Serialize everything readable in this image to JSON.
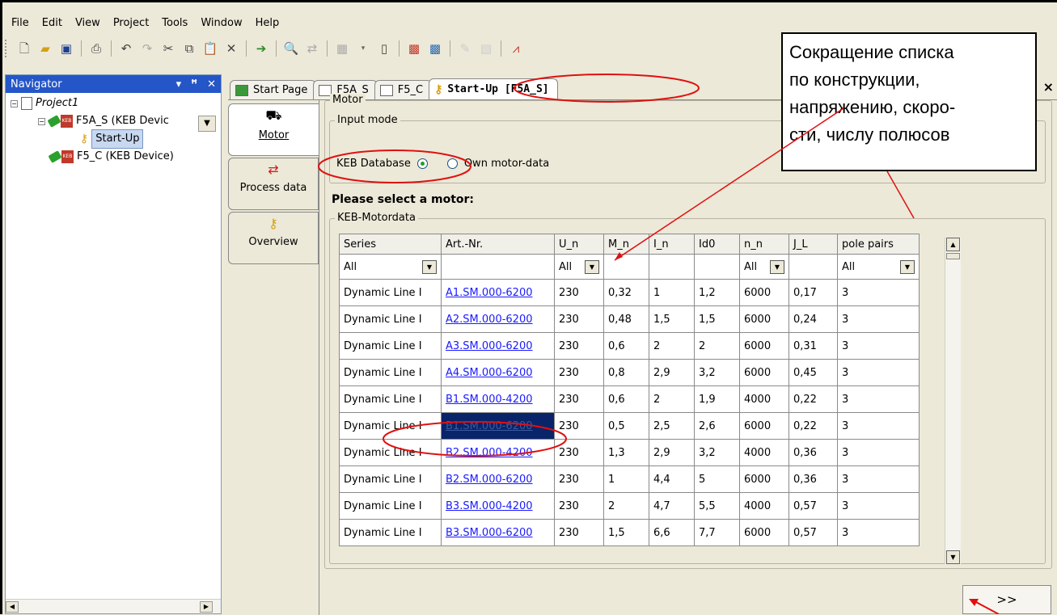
{
  "menu": [
    "File",
    "Edit",
    "View",
    "Project",
    "Tools",
    "Window",
    "Help"
  ],
  "navigator": {
    "title": "Navigator",
    "buttons": [
      "▾",
      "ꟸ",
      "✕"
    ],
    "project": "Project1",
    "device1": "F5A_S (KEB Devic",
    "startup": "Start-Up",
    "device2": "F5_C (KEB Device)"
  },
  "tabs": [
    "Start Page",
    "F5A_S",
    "F5_C",
    "Start-Up [F5A_S]"
  ],
  "side_tabs": [
    "Motor",
    "Process data",
    "Overview"
  ],
  "motor": {
    "group_title": "Motor",
    "input_mode_title": "Input mode",
    "radio_keb": "KEB Database",
    "radio_own": "Own motor-data",
    "please_select": "Please select a motor:",
    "motordata_title": "KEB-Motordata"
  },
  "table": {
    "columns": [
      "Series",
      "Art.-Nr.",
      "U_n",
      "M_n",
      "I_n",
      "Id0",
      "n_n",
      "J_L",
      "pole pairs"
    ],
    "filters": [
      "All",
      "",
      "All",
      "",
      "",
      "",
      "All",
      "",
      "All"
    ],
    "rows": [
      [
        "Dynamic Line I",
        "A1.SM.000-6200",
        "230",
        "0,32",
        "1",
        "1,2",
        "6000",
        "0,17",
        "3"
      ],
      [
        "Dynamic Line I",
        "A2.SM.000-6200",
        "230",
        "0,48",
        "1,5",
        "1,5",
        "6000",
        "0,24",
        "3"
      ],
      [
        "Dynamic Line I",
        "A3.SM.000-6200",
        "230",
        "0,6",
        "2",
        "2",
        "6000",
        "0,31",
        "3"
      ],
      [
        "Dynamic Line I",
        "A4.SM.000-6200",
        "230",
        "0,8",
        "2,9",
        "3,2",
        "6000",
        "0,45",
        "3"
      ],
      [
        "Dynamic Line I",
        "B1.SM.000-4200",
        "230",
        "0,6",
        "2",
        "1,9",
        "4000",
        "0,22",
        "3"
      ],
      [
        "Dynamic Line I",
        "B1.SM.000-6200",
        "230",
        "0,5",
        "2,5",
        "2,6",
        "6000",
        "0,22",
        "3"
      ],
      [
        "Dynamic Line I",
        "B2.SM.000-4200",
        "230",
        "1,3",
        "2,9",
        "3,2",
        "4000",
        "0,36",
        "3"
      ],
      [
        "Dynamic Line I",
        "B2.SM.000-6200",
        "230",
        "1",
        "4,4",
        "5",
        "6000",
        "0,36",
        "3"
      ],
      [
        "Dynamic Line I",
        "B3.SM.000-4200",
        "230",
        "2",
        "4,7",
        "5,5",
        "4000",
        "0,57",
        "3"
      ],
      [
        "Dynamic Line I",
        "B3.SM.000-6200",
        "230",
        "1,5",
        "6,6",
        "7,7",
        "6000",
        "0,57",
        "3"
      ]
    ],
    "selected_row": 5
  },
  "next_button": ">>",
  "close_icon_char": "×",
  "callout": [
    "Сокращение списка",
    "по конструкции,",
    "напряжению, скоро-",
    "сти, числу полюсов"
  ],
  "colors": {
    "annotation_red": "#e01010",
    "navigator_header": "#2456c8",
    "selection": "#0a246a",
    "link": "#1a1aff"
  }
}
